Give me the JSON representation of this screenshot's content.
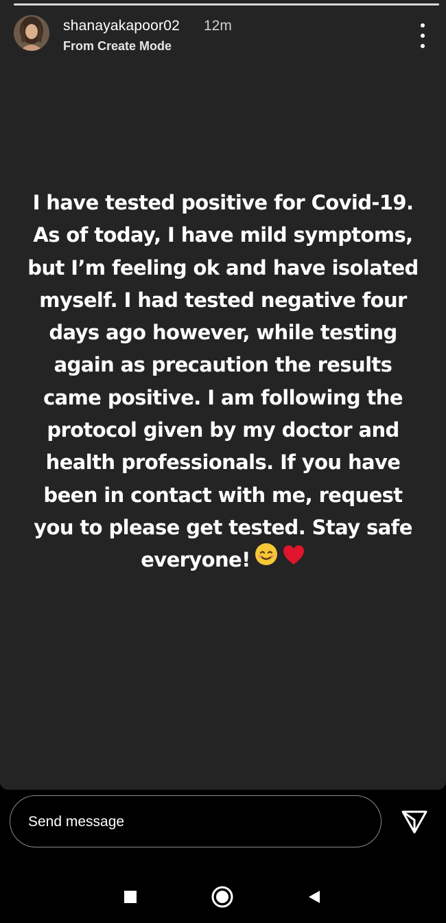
{
  "story": {
    "progress": 1.0,
    "user_name": "shanayakapoor02",
    "time_ago": "12m",
    "sub_label": "From Create Mode",
    "more_icon": "more-vertical-icon",
    "text_lines": [
      "I have tested positive for Covid-19.",
      "As of today, I have mild symptoms,",
      "but I’m feeling ok and have isolated",
      "myself. I had tested negative four",
      "days ago however, while testing",
      "again as precaution the results",
      "came positive. I am following the",
      "protocol given by my doctor and",
      "health professionals. If you have",
      "been in contact with me, request",
      "you to please get tested. Stay safe",
      "everyone!"
    ],
    "emojis": [
      "smiling-face-emoji",
      "red-heart-emoji"
    ]
  },
  "composer": {
    "placeholder": "Send message",
    "send_icon": "send-paper-plane-icon"
  },
  "navbar": {
    "icons": [
      "recents-square-icon",
      "home-circle-icon",
      "back-triangle-icon"
    ]
  },
  "colors": {
    "story_background": "#242424",
    "screen_background": "#000000",
    "text": "#ffffff",
    "heart": "#e0142b",
    "smile": "#f6c737"
  }
}
